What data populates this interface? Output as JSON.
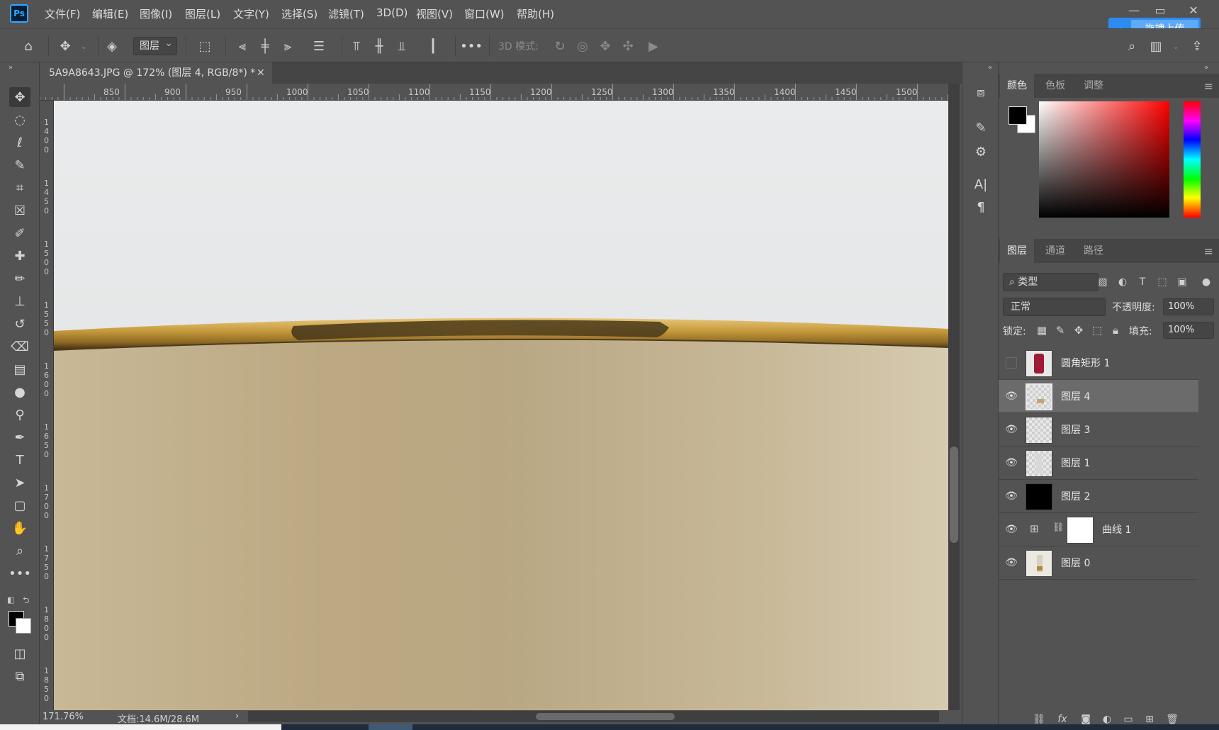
{
  "app": {
    "logo": "Ps"
  },
  "menu": [
    "文件(F)",
    "编辑(E)",
    "图像(I)",
    "图层(L)",
    "文字(Y)",
    "选择(S)",
    "滤镜(T)",
    "3D(D)",
    "视图(V)",
    "窗口(W)",
    "帮助(H)"
  ],
  "upload_button": "拖拽上传",
  "options": {
    "layer_select": "图层",
    "mode_3d": "3D 模式:"
  },
  "document": {
    "tab_title": "5A9A8643.JPG @ 172% (图层 4, RGB/8*) *"
  },
  "ruler": {
    "top": [
      "850",
      "900",
      "950",
      "1000",
      "1050",
      "1100",
      "1150",
      "1200",
      "1250",
      "1300",
      "1350",
      "1400",
      "1450",
      "1500"
    ],
    "left": [
      "1400",
      "1450",
      "1500",
      "1550",
      "1600",
      "1650",
      "1700",
      "1750",
      "1800",
      "1850"
    ]
  },
  "status": {
    "zoom": "171.76%",
    "doc": "文档:14.6M/28.6M"
  },
  "color_panel": {
    "tabs": [
      "颜色",
      "色板",
      "调整"
    ],
    "active_tab": "颜色",
    "foreground": "#000000",
    "background": "#ffffff"
  },
  "layers_panel": {
    "tabs": [
      "图层",
      "通道",
      "路径"
    ],
    "active_tab": "图层",
    "filter": "类型",
    "blend_mode": "正常",
    "opacity_label": "不透明度:",
    "opacity": "100%",
    "lock_label": "锁定:",
    "fill_label": "填充:",
    "fill": "100%",
    "layers": [
      {
        "name": "圆角矩形 1",
        "visible": false,
        "selected": false
      },
      {
        "name": "图层 4",
        "visible": true,
        "selected": true
      },
      {
        "name": "图层 3",
        "visible": true,
        "selected": false
      },
      {
        "name": "图层 1",
        "visible": true,
        "selected": false
      },
      {
        "name": "图层 2",
        "visible": true,
        "selected": false
      },
      {
        "name": "曲线 1",
        "visible": true,
        "selected": false
      },
      {
        "name": "图层 0",
        "visible": true,
        "selected": false
      }
    ]
  },
  "colors": {
    "accent": "#2d8cf0",
    "brand": "#31a8ff",
    "gold": "#b08a3a",
    "beige": "#cdbb98"
  }
}
